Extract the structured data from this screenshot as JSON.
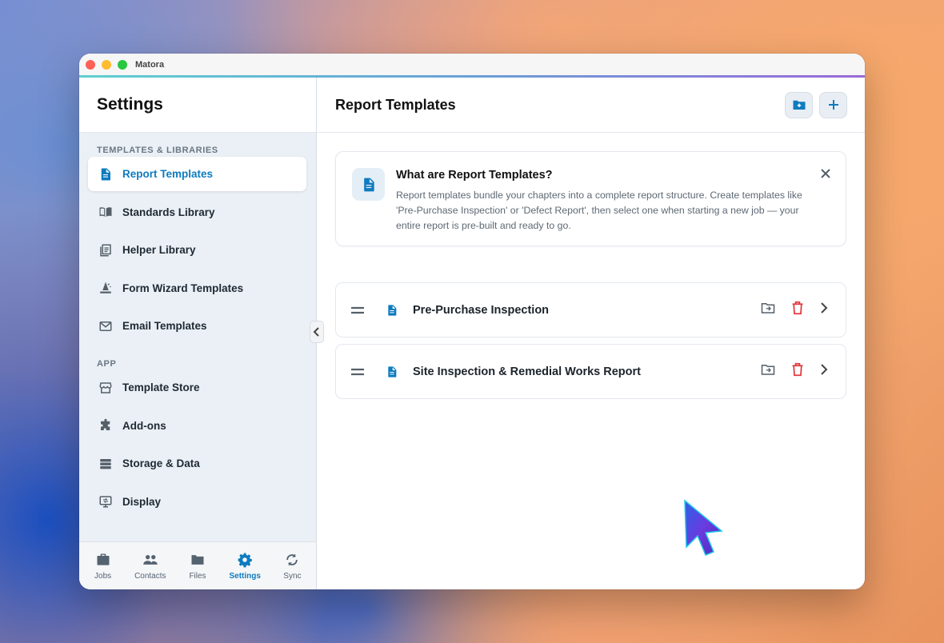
{
  "window": {
    "app_title": "Matora"
  },
  "sidebar": {
    "title": "Settings",
    "sections": [
      {
        "label": "TEMPLATES & LIBRARIES",
        "items": [
          {
            "label": "Report Templates",
            "icon": "document-icon",
            "active": true
          },
          {
            "label": "Standards Library",
            "icon": "book-icon"
          },
          {
            "label": "Helper Library",
            "icon": "library-icon"
          },
          {
            "label": "Form Wizard Templates",
            "icon": "wizard-hat-icon"
          },
          {
            "label": "Email Templates",
            "icon": "envelope-icon"
          }
        ]
      },
      {
        "label": "APP",
        "items": [
          {
            "label": "Template Store",
            "icon": "storefront-icon"
          },
          {
            "label": "Add-ons",
            "icon": "puzzle-icon"
          },
          {
            "label": "Storage & Data",
            "icon": "storage-icon"
          },
          {
            "label": "Display",
            "icon": "display-icon"
          }
        ]
      }
    ],
    "bottom_tabs": [
      {
        "label": "Jobs",
        "icon": "briefcase-icon"
      },
      {
        "label": "Contacts",
        "icon": "people-icon"
      },
      {
        "label": "Files",
        "icon": "folder-icon"
      },
      {
        "label": "Settings",
        "icon": "gear-icon",
        "active": true
      },
      {
        "label": "Sync",
        "icon": "sync-icon"
      }
    ]
  },
  "main": {
    "title": "Report Templates",
    "info": {
      "title": "What are Report Templates?",
      "body": "Report templates bundle your chapters into a complete report structure. Create templates like 'Pre-Purchase Inspection' or 'Defect Report', then select one when starting a new job — your entire report is pre-built and ready to go."
    },
    "templates": [
      {
        "name": "Pre-Purchase Inspection"
      },
      {
        "name": "Site Inspection & Remedial Works Report"
      }
    ]
  },
  "colors": {
    "accent": "#0e7bbf",
    "delete": "#e0393e"
  }
}
